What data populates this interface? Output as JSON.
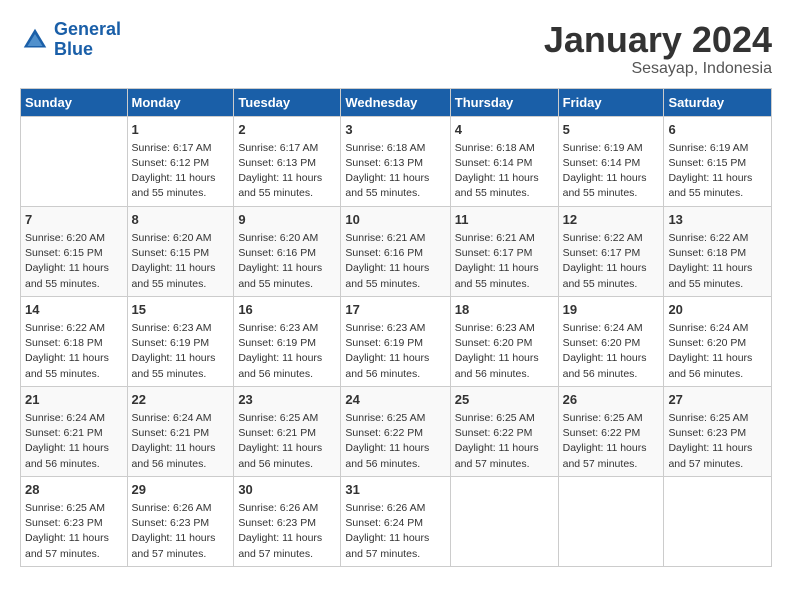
{
  "header": {
    "logo_line1": "General",
    "logo_line2": "Blue",
    "month_year": "January 2024",
    "location": "Sesayap, Indonesia"
  },
  "days_of_week": [
    "Sunday",
    "Monday",
    "Tuesday",
    "Wednesday",
    "Thursday",
    "Friday",
    "Saturday"
  ],
  "weeks": [
    [
      {
        "day": "",
        "info": ""
      },
      {
        "day": "1",
        "info": "Sunrise: 6:17 AM\nSunset: 6:12 PM\nDaylight: 11 hours\nand 55 minutes."
      },
      {
        "day": "2",
        "info": "Sunrise: 6:17 AM\nSunset: 6:13 PM\nDaylight: 11 hours\nand 55 minutes."
      },
      {
        "day": "3",
        "info": "Sunrise: 6:18 AM\nSunset: 6:13 PM\nDaylight: 11 hours\nand 55 minutes."
      },
      {
        "day": "4",
        "info": "Sunrise: 6:18 AM\nSunset: 6:14 PM\nDaylight: 11 hours\nand 55 minutes."
      },
      {
        "day": "5",
        "info": "Sunrise: 6:19 AM\nSunset: 6:14 PM\nDaylight: 11 hours\nand 55 minutes."
      },
      {
        "day": "6",
        "info": "Sunrise: 6:19 AM\nSunset: 6:15 PM\nDaylight: 11 hours\nand 55 minutes."
      }
    ],
    [
      {
        "day": "7",
        "info": "Sunrise: 6:20 AM\nSunset: 6:15 PM\nDaylight: 11 hours\nand 55 minutes."
      },
      {
        "day": "8",
        "info": "Sunrise: 6:20 AM\nSunset: 6:15 PM\nDaylight: 11 hours\nand 55 minutes."
      },
      {
        "day": "9",
        "info": "Sunrise: 6:20 AM\nSunset: 6:16 PM\nDaylight: 11 hours\nand 55 minutes."
      },
      {
        "day": "10",
        "info": "Sunrise: 6:21 AM\nSunset: 6:16 PM\nDaylight: 11 hours\nand 55 minutes."
      },
      {
        "day": "11",
        "info": "Sunrise: 6:21 AM\nSunset: 6:17 PM\nDaylight: 11 hours\nand 55 minutes."
      },
      {
        "day": "12",
        "info": "Sunrise: 6:22 AM\nSunset: 6:17 PM\nDaylight: 11 hours\nand 55 minutes."
      },
      {
        "day": "13",
        "info": "Sunrise: 6:22 AM\nSunset: 6:18 PM\nDaylight: 11 hours\nand 55 minutes."
      }
    ],
    [
      {
        "day": "14",
        "info": "Sunrise: 6:22 AM\nSunset: 6:18 PM\nDaylight: 11 hours\nand 55 minutes."
      },
      {
        "day": "15",
        "info": "Sunrise: 6:23 AM\nSunset: 6:19 PM\nDaylight: 11 hours\nand 55 minutes."
      },
      {
        "day": "16",
        "info": "Sunrise: 6:23 AM\nSunset: 6:19 PM\nDaylight: 11 hours\nand 56 minutes."
      },
      {
        "day": "17",
        "info": "Sunrise: 6:23 AM\nSunset: 6:19 PM\nDaylight: 11 hours\nand 56 minutes."
      },
      {
        "day": "18",
        "info": "Sunrise: 6:23 AM\nSunset: 6:20 PM\nDaylight: 11 hours\nand 56 minutes."
      },
      {
        "day": "19",
        "info": "Sunrise: 6:24 AM\nSunset: 6:20 PM\nDaylight: 11 hours\nand 56 minutes."
      },
      {
        "day": "20",
        "info": "Sunrise: 6:24 AM\nSunset: 6:20 PM\nDaylight: 11 hours\nand 56 minutes."
      }
    ],
    [
      {
        "day": "21",
        "info": "Sunrise: 6:24 AM\nSunset: 6:21 PM\nDaylight: 11 hours\nand 56 minutes."
      },
      {
        "day": "22",
        "info": "Sunrise: 6:24 AM\nSunset: 6:21 PM\nDaylight: 11 hours\nand 56 minutes."
      },
      {
        "day": "23",
        "info": "Sunrise: 6:25 AM\nSunset: 6:21 PM\nDaylight: 11 hours\nand 56 minutes."
      },
      {
        "day": "24",
        "info": "Sunrise: 6:25 AM\nSunset: 6:22 PM\nDaylight: 11 hours\nand 56 minutes."
      },
      {
        "day": "25",
        "info": "Sunrise: 6:25 AM\nSunset: 6:22 PM\nDaylight: 11 hours\nand 57 minutes."
      },
      {
        "day": "26",
        "info": "Sunrise: 6:25 AM\nSunset: 6:22 PM\nDaylight: 11 hours\nand 57 minutes."
      },
      {
        "day": "27",
        "info": "Sunrise: 6:25 AM\nSunset: 6:23 PM\nDaylight: 11 hours\nand 57 minutes."
      }
    ],
    [
      {
        "day": "28",
        "info": "Sunrise: 6:25 AM\nSunset: 6:23 PM\nDaylight: 11 hours\nand 57 minutes."
      },
      {
        "day": "29",
        "info": "Sunrise: 6:26 AM\nSunset: 6:23 PM\nDaylight: 11 hours\nand 57 minutes."
      },
      {
        "day": "30",
        "info": "Sunrise: 6:26 AM\nSunset: 6:23 PM\nDaylight: 11 hours\nand 57 minutes."
      },
      {
        "day": "31",
        "info": "Sunrise: 6:26 AM\nSunset: 6:24 PM\nDaylight: 11 hours\nand 57 minutes."
      },
      {
        "day": "",
        "info": ""
      },
      {
        "day": "",
        "info": ""
      },
      {
        "day": "",
        "info": ""
      }
    ]
  ]
}
